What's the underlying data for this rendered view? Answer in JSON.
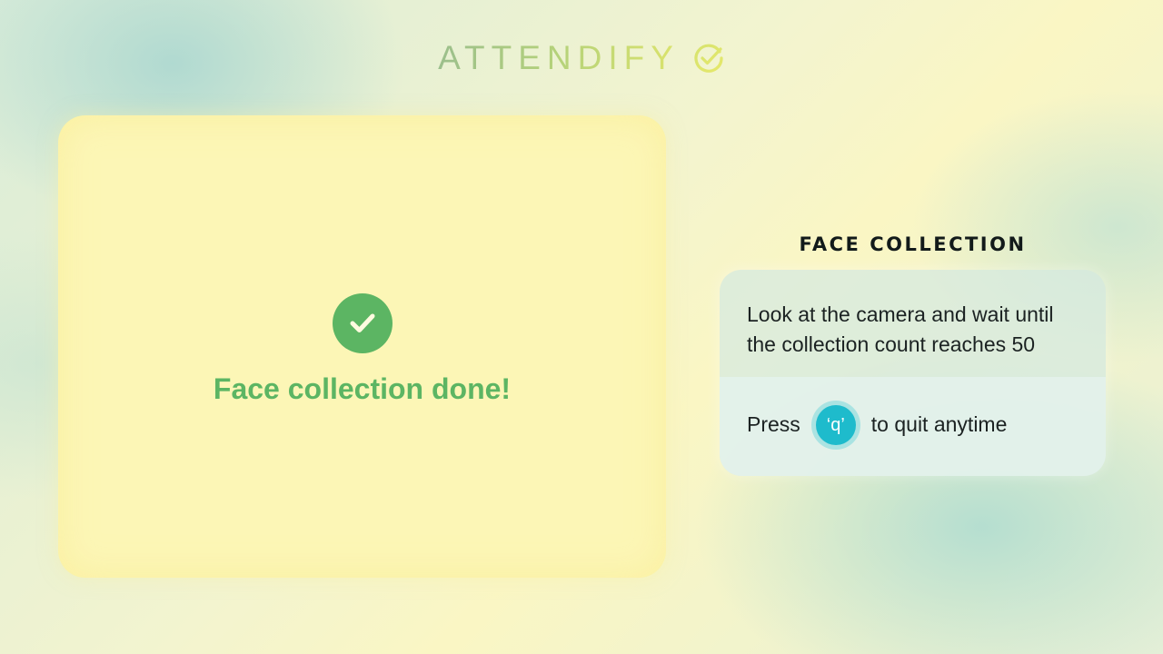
{
  "brand": {
    "name": "ATTENDIFY",
    "icon": "check-circle-icon"
  },
  "camera_panel": {
    "status_icon": "checkmark-icon",
    "status_text": "Face collection done!",
    "status_color": "#5cb563",
    "background_color": "#fcf6b6"
  },
  "instructions": {
    "title": "FACE COLLECTION",
    "message": "Look at the camera and wait until the collection count reaches 50",
    "quit_prefix": "Press",
    "quit_key": "‘q’",
    "quit_suffix": "to quit anytime",
    "key_color": "#1ebbcc"
  }
}
